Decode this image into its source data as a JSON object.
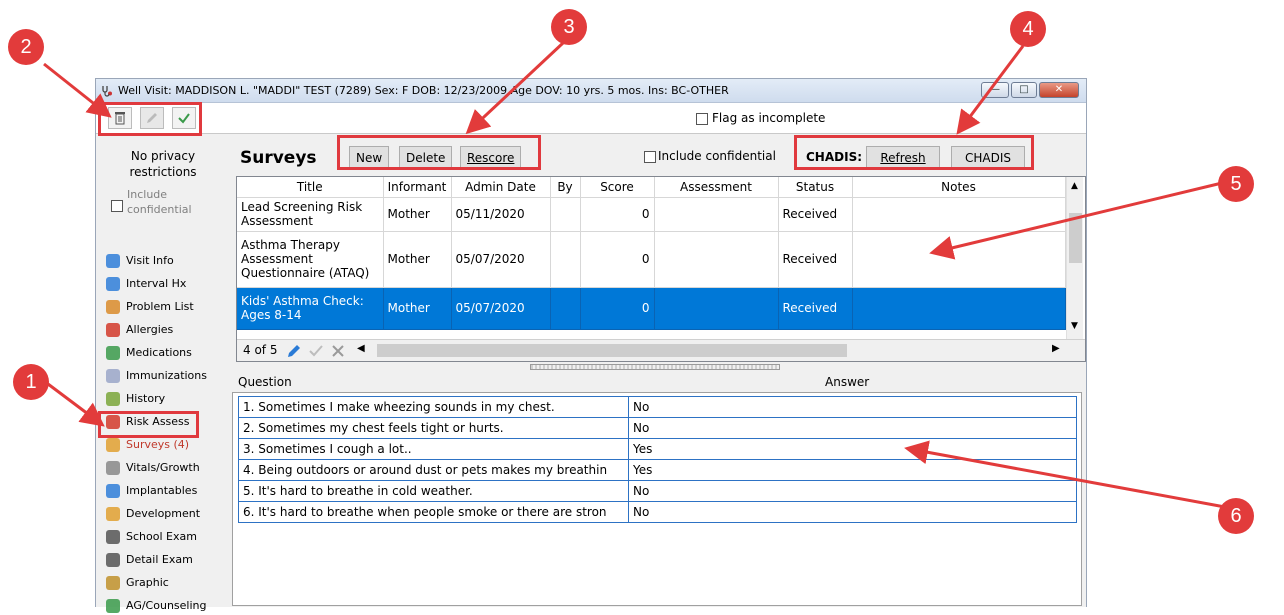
{
  "window": {
    "title": "Well Visit: MADDISON L. \"MADDI\" TEST (7289)  Sex: F  DOB: 12/23/2009  Age DOV: 10 yrs. 5 mos.  Ins: BC-OTHER",
    "flag_label": "Flag as incomplete"
  },
  "leftnav": {
    "privacy": "No privacy restrictions",
    "include_confidential": "Include confidential",
    "items": [
      {
        "label": "Visit Info",
        "icon": "visit-info-icon"
      },
      {
        "label": "Interval Hx",
        "icon": "interval-hx-icon"
      },
      {
        "label": "Problem List",
        "icon": "problem-list-icon"
      },
      {
        "label": "Allergies",
        "icon": "allergies-icon"
      },
      {
        "label": "Medications",
        "icon": "medications-icon"
      },
      {
        "label": "Immunizations",
        "icon": "immunizations-icon"
      },
      {
        "label": "History",
        "icon": "history-icon"
      },
      {
        "label": "Risk Assess",
        "icon": "risk-assess-icon"
      },
      {
        "label": "Surveys (4)",
        "icon": "surveys-icon"
      },
      {
        "label": "Vitals/Growth",
        "icon": "vitals-icon"
      },
      {
        "label": "Implantables",
        "icon": "implantables-icon"
      },
      {
        "label": "Development",
        "icon": "development-icon"
      },
      {
        "label": "School Exam",
        "icon": "stethoscope-icon"
      },
      {
        "label": "Detail Exam",
        "icon": "stethoscope-icon"
      },
      {
        "label": "Graphic",
        "icon": "graphic-icon"
      },
      {
        "label": "AG/Counseling",
        "icon": "counseling-icon"
      }
    ]
  },
  "surveys": {
    "heading": "Surveys",
    "new_label": "New",
    "delete_label": "Delete",
    "rescore_label": "Rescore",
    "include_confidential": "Include confidential",
    "chadis_label": "CHADIS:",
    "refresh_label": "Refresh",
    "chadis_button": "CHADIS",
    "columns": [
      "Title",
      "Informant",
      "Admin Date",
      "By",
      "Score",
      "Assessment",
      "Status",
      "Notes"
    ],
    "rows": [
      {
        "title": "Lead Screening Risk Assessment",
        "informant": "Mother",
        "date": "05/11/2020",
        "by": "",
        "score": "0",
        "assessment": "",
        "status": "Received",
        "notes": ""
      },
      {
        "title": "Asthma Therapy Assessment Questionnaire (ATAQ)",
        "informant": "Mother",
        "date": "05/07/2020",
        "by": "",
        "score": "0",
        "assessment": "",
        "status": "Received",
        "notes": ""
      },
      {
        "title": "Kids' Asthma Check: Ages 8-14",
        "informant": "Mother",
        "date": "05/07/2020",
        "by": "",
        "score": "0",
        "assessment": "",
        "status": "Received",
        "notes": ""
      }
    ],
    "pager": "4 of 5"
  },
  "questions": {
    "question_header": "Question",
    "answer_header": "Answer",
    "rows": [
      {
        "q": "1. Sometimes I make wheezing sounds in my chest.",
        "a": "No"
      },
      {
        "q": "2. Sometimes my chest feels tight or hurts.",
        "a": "No"
      },
      {
        "q": "3. Sometimes I cough a lot..",
        "a": "Yes"
      },
      {
        "q": "4. Being outdoors or around dust or pets makes my breathin",
        "a": "Yes"
      },
      {
        "q": "5. It's hard to breathe in cold weather.",
        "a": "No"
      },
      {
        "q": "6. It's hard to breathe when people smoke or there are stron",
        "a": "No"
      }
    ]
  },
  "annotations": [
    "1",
    "2",
    "3",
    "4",
    "5",
    "6"
  ],
  "colors": {
    "annotation": "#e23b3b",
    "selection": "#0078d7",
    "grid_border": "#2d72c4"
  }
}
